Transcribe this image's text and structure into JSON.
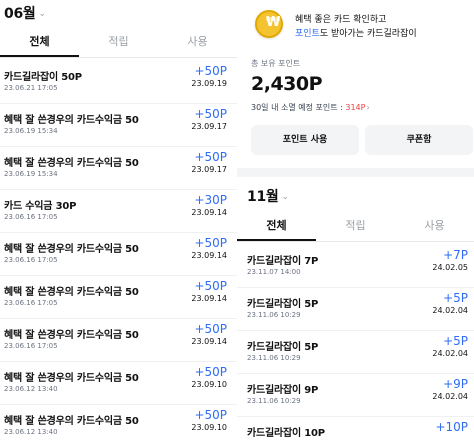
{
  "left": {
    "month": "06월",
    "tabs": [
      "전체",
      "적립",
      "사용"
    ],
    "rows": [
      {
        "title": "카드길라잡이 50P",
        "date": "23.06.21  17:05",
        "points": "+50P",
        "expiry": "23.09.19"
      },
      {
        "title": "혜택 잘 쓴경우의 카드수익금 50",
        "date": "23.06.19  15:34",
        "points": "+50P",
        "expiry": "23.09.17"
      },
      {
        "title": "혜택 잘 쓴경우의 카드수익금 50",
        "date": "23.06.19  15:34",
        "points": "+50P",
        "expiry": "23.09.17"
      },
      {
        "title": "카드 수익금 30P",
        "date": "23.06.16  17:05",
        "points": "+30P",
        "expiry": "23.09.14"
      },
      {
        "title": "혜택 잘 쓴경우의 카드수익금 50",
        "date": "23.06.16  17:05",
        "points": "+50P",
        "expiry": "23.09.14"
      },
      {
        "title": "혜택 잘 쓴경우의 카드수익금 50",
        "date": "23.06.16  17:05",
        "points": "+50P",
        "expiry": "23.09.14"
      },
      {
        "title": "혜택 잘 쓴경우의 카드수익금 50",
        "date": "23.06.16  17:05",
        "points": "+50P",
        "expiry": "23.09.14"
      },
      {
        "title": "혜택 잘 쓴경우의 카드수익금 50",
        "date": "23.06.12  13:40",
        "points": "+50P",
        "expiry": "23.09.10"
      },
      {
        "title": "혜택 잘 쓴경우의 카드수익금 50",
        "date": "23.06.12  13:40",
        "points": "+50P",
        "expiry": "23.09.10"
      }
    ]
  },
  "right": {
    "banner": {
      "line1": "혜택 좋은 카드 확인하고",
      "line2_highlight": "포인트",
      "line2_rest": "도 받아가는 카드길라잡이"
    },
    "total_label": "총 보유 포인트",
    "total_value": "2,430P",
    "expire_prefix": "30일 내 소멸 예정 포인트 : ",
    "expire_value": "314P",
    "expire_chevron": "›",
    "buttons": {
      "use": "포인트 사용",
      "coupon": "쿠폰함"
    },
    "month": "11월",
    "tabs": [
      "전체",
      "적립",
      "사용"
    ],
    "rows": [
      {
        "title": "카드길라잡이 7P",
        "date": "23.11.07  14:00",
        "points": "+7P",
        "expiry": "24.02.05"
      },
      {
        "title": "카드길라잡이 5P",
        "date": "23.11.06  10:29",
        "points": "+5P",
        "expiry": "24.02.04"
      },
      {
        "title": "카드길라잡이 5P",
        "date": "23.11.06  10:29",
        "points": "+5P",
        "expiry": "24.02.04"
      },
      {
        "title": "카드길라잡이 9P",
        "date": "23.11.06  10:29",
        "points": "+9P",
        "expiry": "24.02.04"
      },
      {
        "title": "카드길라잡이 10P",
        "date": "",
        "points": "+10P",
        "expiry": ""
      }
    ]
  },
  "icons": {
    "coin": "coin-icon",
    "chevron": "chevron-down-icon"
  },
  "colors": {
    "accent_blue": "#2f6df6",
    "expire_red": "#ef4444",
    "coin_gold": "#f4c430"
  }
}
